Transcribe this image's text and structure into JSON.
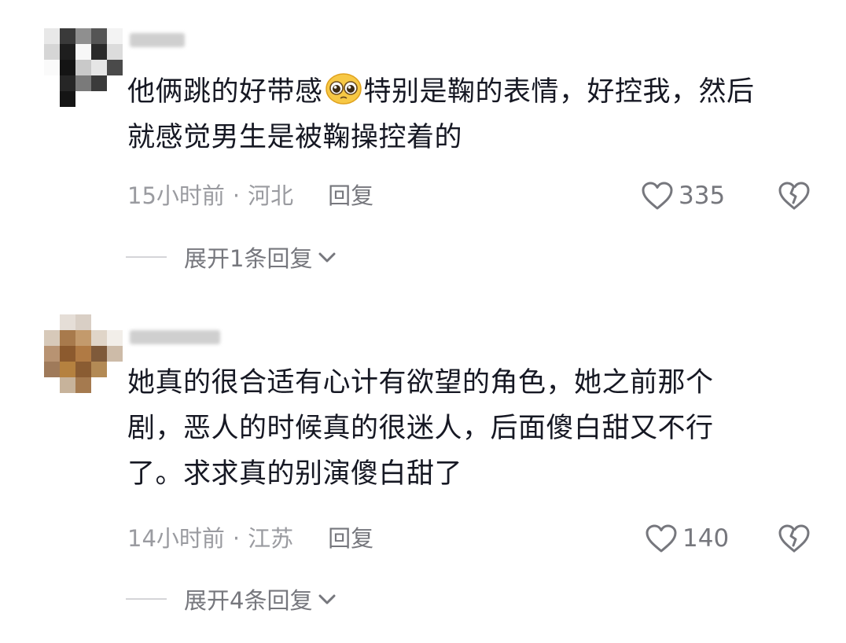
{
  "comments": [
    {
      "lines": [
        "他俩跳的好带感",
        "特别是鞠的表情，好控我，然后",
        "就感觉男生是被鞠操控着的"
      ],
      "emoji": "pleading-face-emoji",
      "time": "15小时前",
      "separator": "·",
      "location": "河北",
      "reply_label": "回复",
      "likes": "335",
      "expand_label": "展开1条回复"
    },
    {
      "lines": [
        "她真的很合适有心计有欲望的角色，她之前那个",
        "剧，恶人的时候真的很迷人，后面傻白甜又不行",
        "了。求求真的别演傻白甜了"
      ],
      "time": "14小时前",
      "separator": "·",
      "location": "江苏",
      "reply_label": "回复",
      "likes": "140",
      "expand_label": "展开4条回复"
    }
  ],
  "icons": {
    "like": "heart-outline-icon",
    "dislike": "broken-heart-icon",
    "expand": "chevron-down-icon"
  },
  "colors": {
    "text": "#161823",
    "meta": "#9a9ba0",
    "action": "#76777d"
  }
}
